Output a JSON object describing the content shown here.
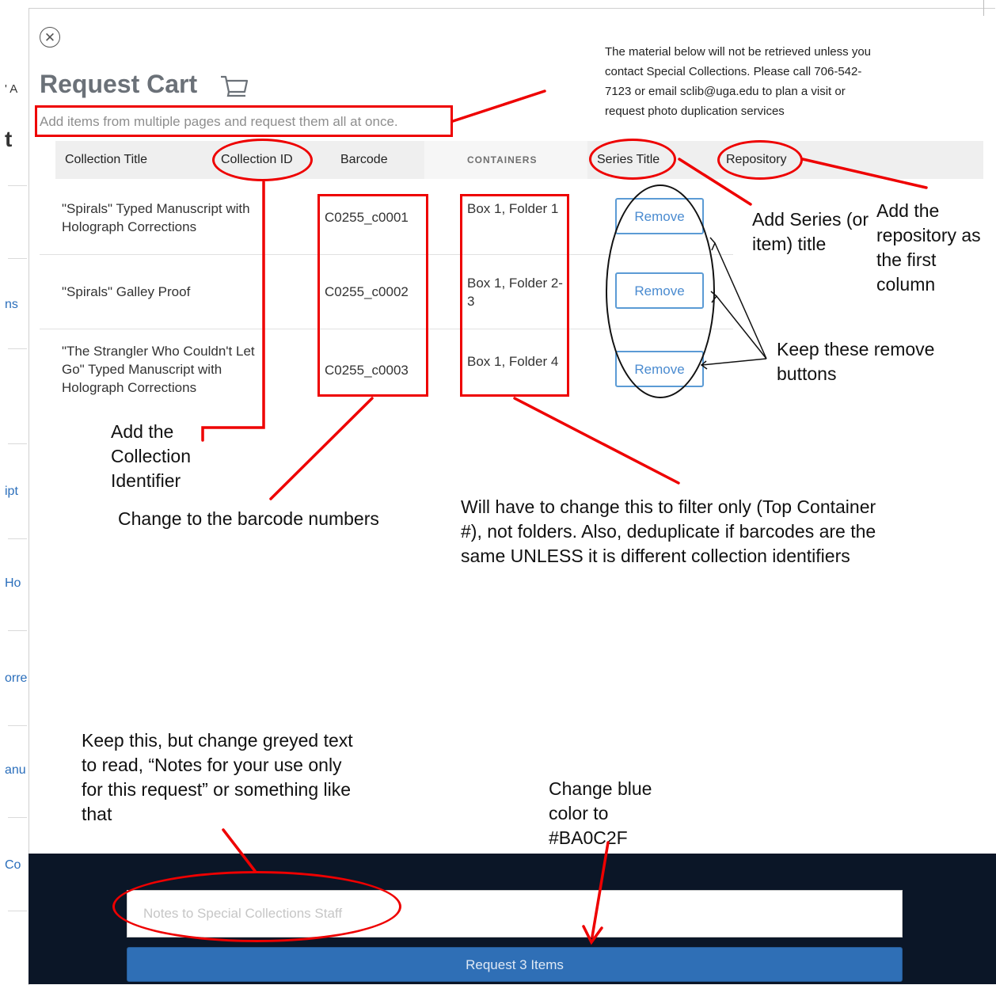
{
  "background_page": {
    "fragments": [
      "' A",
      "t",
      "ns",
      "ipt",
      "Ho",
      "orre",
      "anu",
      "Co"
    ]
  },
  "modal": {
    "close_icon": "close-circle-icon",
    "title": "Request Cart",
    "cart_icon": "shopping-cart-icon",
    "subtitle": "Add items from multiple pages and request them all at once.",
    "notice": "The material below will not be retrieved unless you contact Special Collections. Please call 706-542-7123 or email sclib@uga.edu to plan a visit or request photo duplication services",
    "columns": [
      "Collection Title",
      "Collection ID",
      "Barcode",
      "CONTAINERS",
      "Series Title",
      "Repository"
    ],
    "rows": [
      {
        "title": "\"Spirals\" Typed Manuscript with Holograph Corrections",
        "barcode": "C0255_c0001",
        "container": "Box 1, Folder 1",
        "action": "Remove"
      },
      {
        "title": "\"Spirals\" Galley Proof",
        "barcode": "C0255_c0002",
        "container": "Box 1, Folder 2-3",
        "action": "Remove"
      },
      {
        "title": "\"The Strangler Who Couldn't Let Go\" Typed Manuscript with Holograph Corrections",
        "barcode": "C0255_c0003",
        "container": "Box 1, Folder 4",
        "action": "Remove"
      }
    ],
    "notes_placeholder": "Notes to Special Collections Staff",
    "submit_label": "Request 3 Items"
  },
  "annotations": {
    "series_title": "Add Series (or item) title",
    "repository": "Add the repository as the first column",
    "keep_remove": "Keep these remove buttons",
    "collection_id": "Add the Collection Identifier",
    "barcode": "Change to the barcode numbers",
    "containers": "Will have to change this to filter only (Top Container #), not folders. Also, deduplicate if barcodes are the same UNLESS it is different collection identifiers",
    "notes": "Keep this, but change greyed text to read, “Notes for your use only for this request” or something like that",
    "color": "Change blue color to #BA0C2F",
    "annotation_color": "#EE0000"
  },
  "colors": {
    "title_gray": "#6B7178",
    "remove_blue": "#4A8BD0",
    "submit_blue": "#2F6FB6",
    "footer_navy": "#0B1627"
  }
}
